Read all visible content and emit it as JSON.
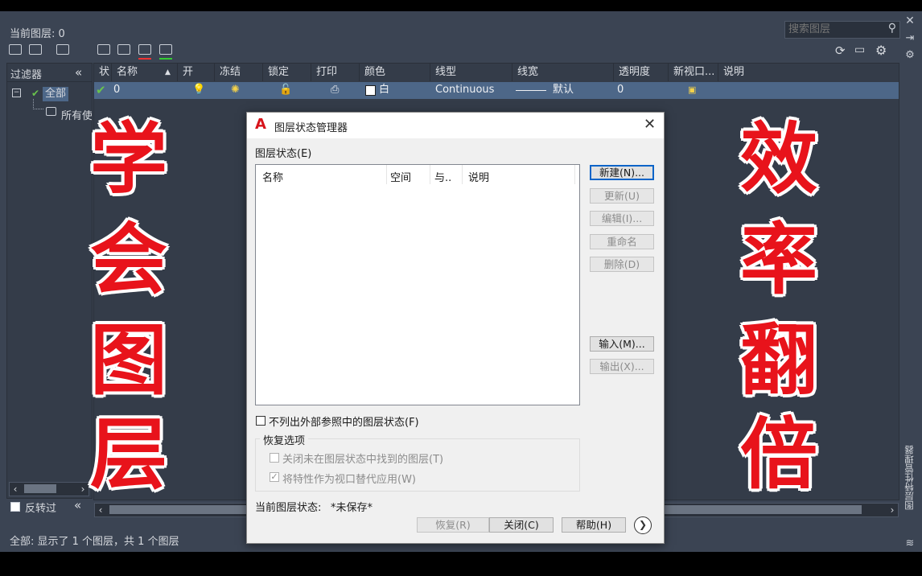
{
  "palette": {
    "current_layer": "当前图层: 0",
    "search_placeholder": "搜索图层",
    "status": "全部: 显示了 1 个图层，共 1 个图层",
    "side_label": "图层特性管理器"
  },
  "filters": {
    "header": "过滤器",
    "collapse": "«",
    "root": "全部",
    "child": "所有使",
    "invert_label": "反转过",
    "invert_collapse": "«"
  },
  "grid": {
    "columns": [
      "状",
      "名称",
      "开",
      "冻结",
      "锁定",
      "打印",
      "颜色",
      "线型",
      "线宽",
      "透明度",
      "新视口...",
      "说明"
    ],
    "row": {
      "name": "0",
      "color": "白",
      "linetype": "Continuous",
      "lineweight": "默认",
      "transparency": "0"
    }
  },
  "dialog": {
    "title": "图层状态管理器",
    "group_label": "图层状态(E)",
    "list_columns": [
      "名称",
      "空间",
      "与..",
      "说明"
    ],
    "buttons": {
      "new": "新建(N)...",
      "update": "更新(U)",
      "edit": "编辑(I)...",
      "rename": "重命名",
      "delete": "删除(D)",
      "import": "输入(M)...",
      "export": "输出(X)..."
    },
    "exclude_xref": "不列出外部参照中的图层状态(F)",
    "restore_group": "恢复选项",
    "restore_opt1": "关闭未在图层状态中找到的图层(T)",
    "restore_opt2": "将特性作为视口替代应用(W)",
    "current_state_label": "当前图层状态:",
    "current_state_value": "*未保存*",
    "bottom_buttons": {
      "restore": "恢复(R)",
      "close": "关闭(C)",
      "help": "帮助(H)"
    }
  },
  "overlay": {
    "left": [
      "学",
      "会",
      "图",
      "层"
    ],
    "right": [
      "效",
      "率",
      "翻",
      "倍"
    ]
  },
  "colors": {
    "palette_bg": "#3b4453",
    "overlay_red": "#e8131b",
    "selection": "#4d6788"
  }
}
